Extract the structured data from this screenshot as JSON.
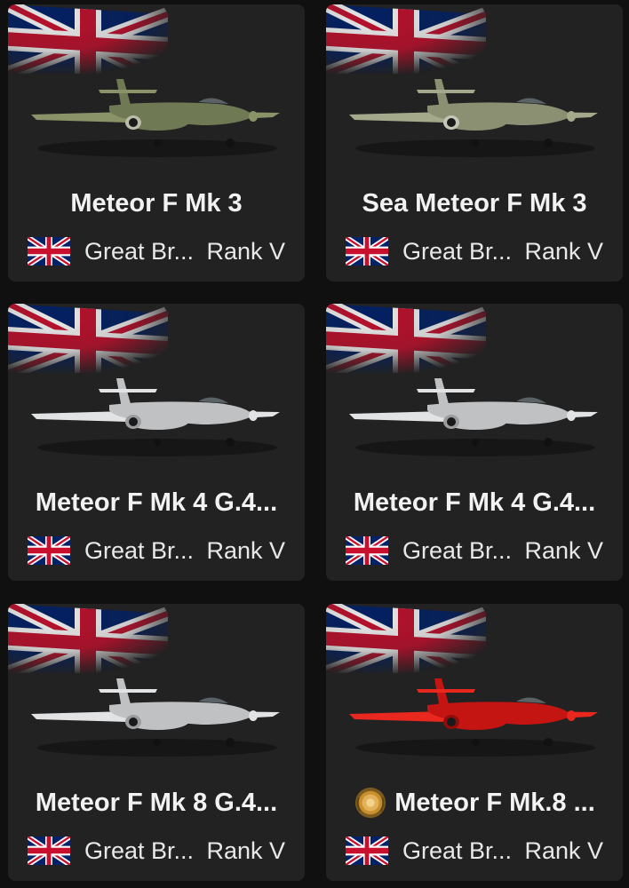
{
  "cards": [
    {
      "name": "Meteor F Mk 3",
      "country": "Great Br...",
      "rank": "Rank V",
      "livery": "green",
      "premium": false
    },
    {
      "name": "Sea Meteor F Mk 3",
      "country": "Great Br...",
      "rank": "Rank V",
      "livery": "greygreen",
      "premium": false
    },
    {
      "name": "Meteor F Mk 4 G.4...",
      "country": "Great Br...",
      "rank": "Rank V",
      "livery": "silver",
      "premium": false
    },
    {
      "name": "Meteor F Mk 4 G.4...",
      "country": "Great Br...",
      "rank": "Rank V",
      "livery": "silver",
      "premium": false
    },
    {
      "name": "Meteor F Mk 8 G.4...",
      "country": "Great Br...",
      "rank": "Rank V",
      "livery": "silver",
      "premium": false
    },
    {
      "name": "Meteor F Mk.8 ...",
      "country": "Great Br...",
      "rank": "Rank V",
      "livery": "red",
      "premium": true
    }
  ],
  "icons": {
    "country_flag": "union-jack-icon",
    "premium_badge": "gold-medal-icon"
  },
  "colors": {
    "card_bg": "#222223",
    "page_bg": "#101010",
    "text": "#f2f2f2",
    "flag_blue": "#012169",
    "flag_red": "#C8102E"
  }
}
